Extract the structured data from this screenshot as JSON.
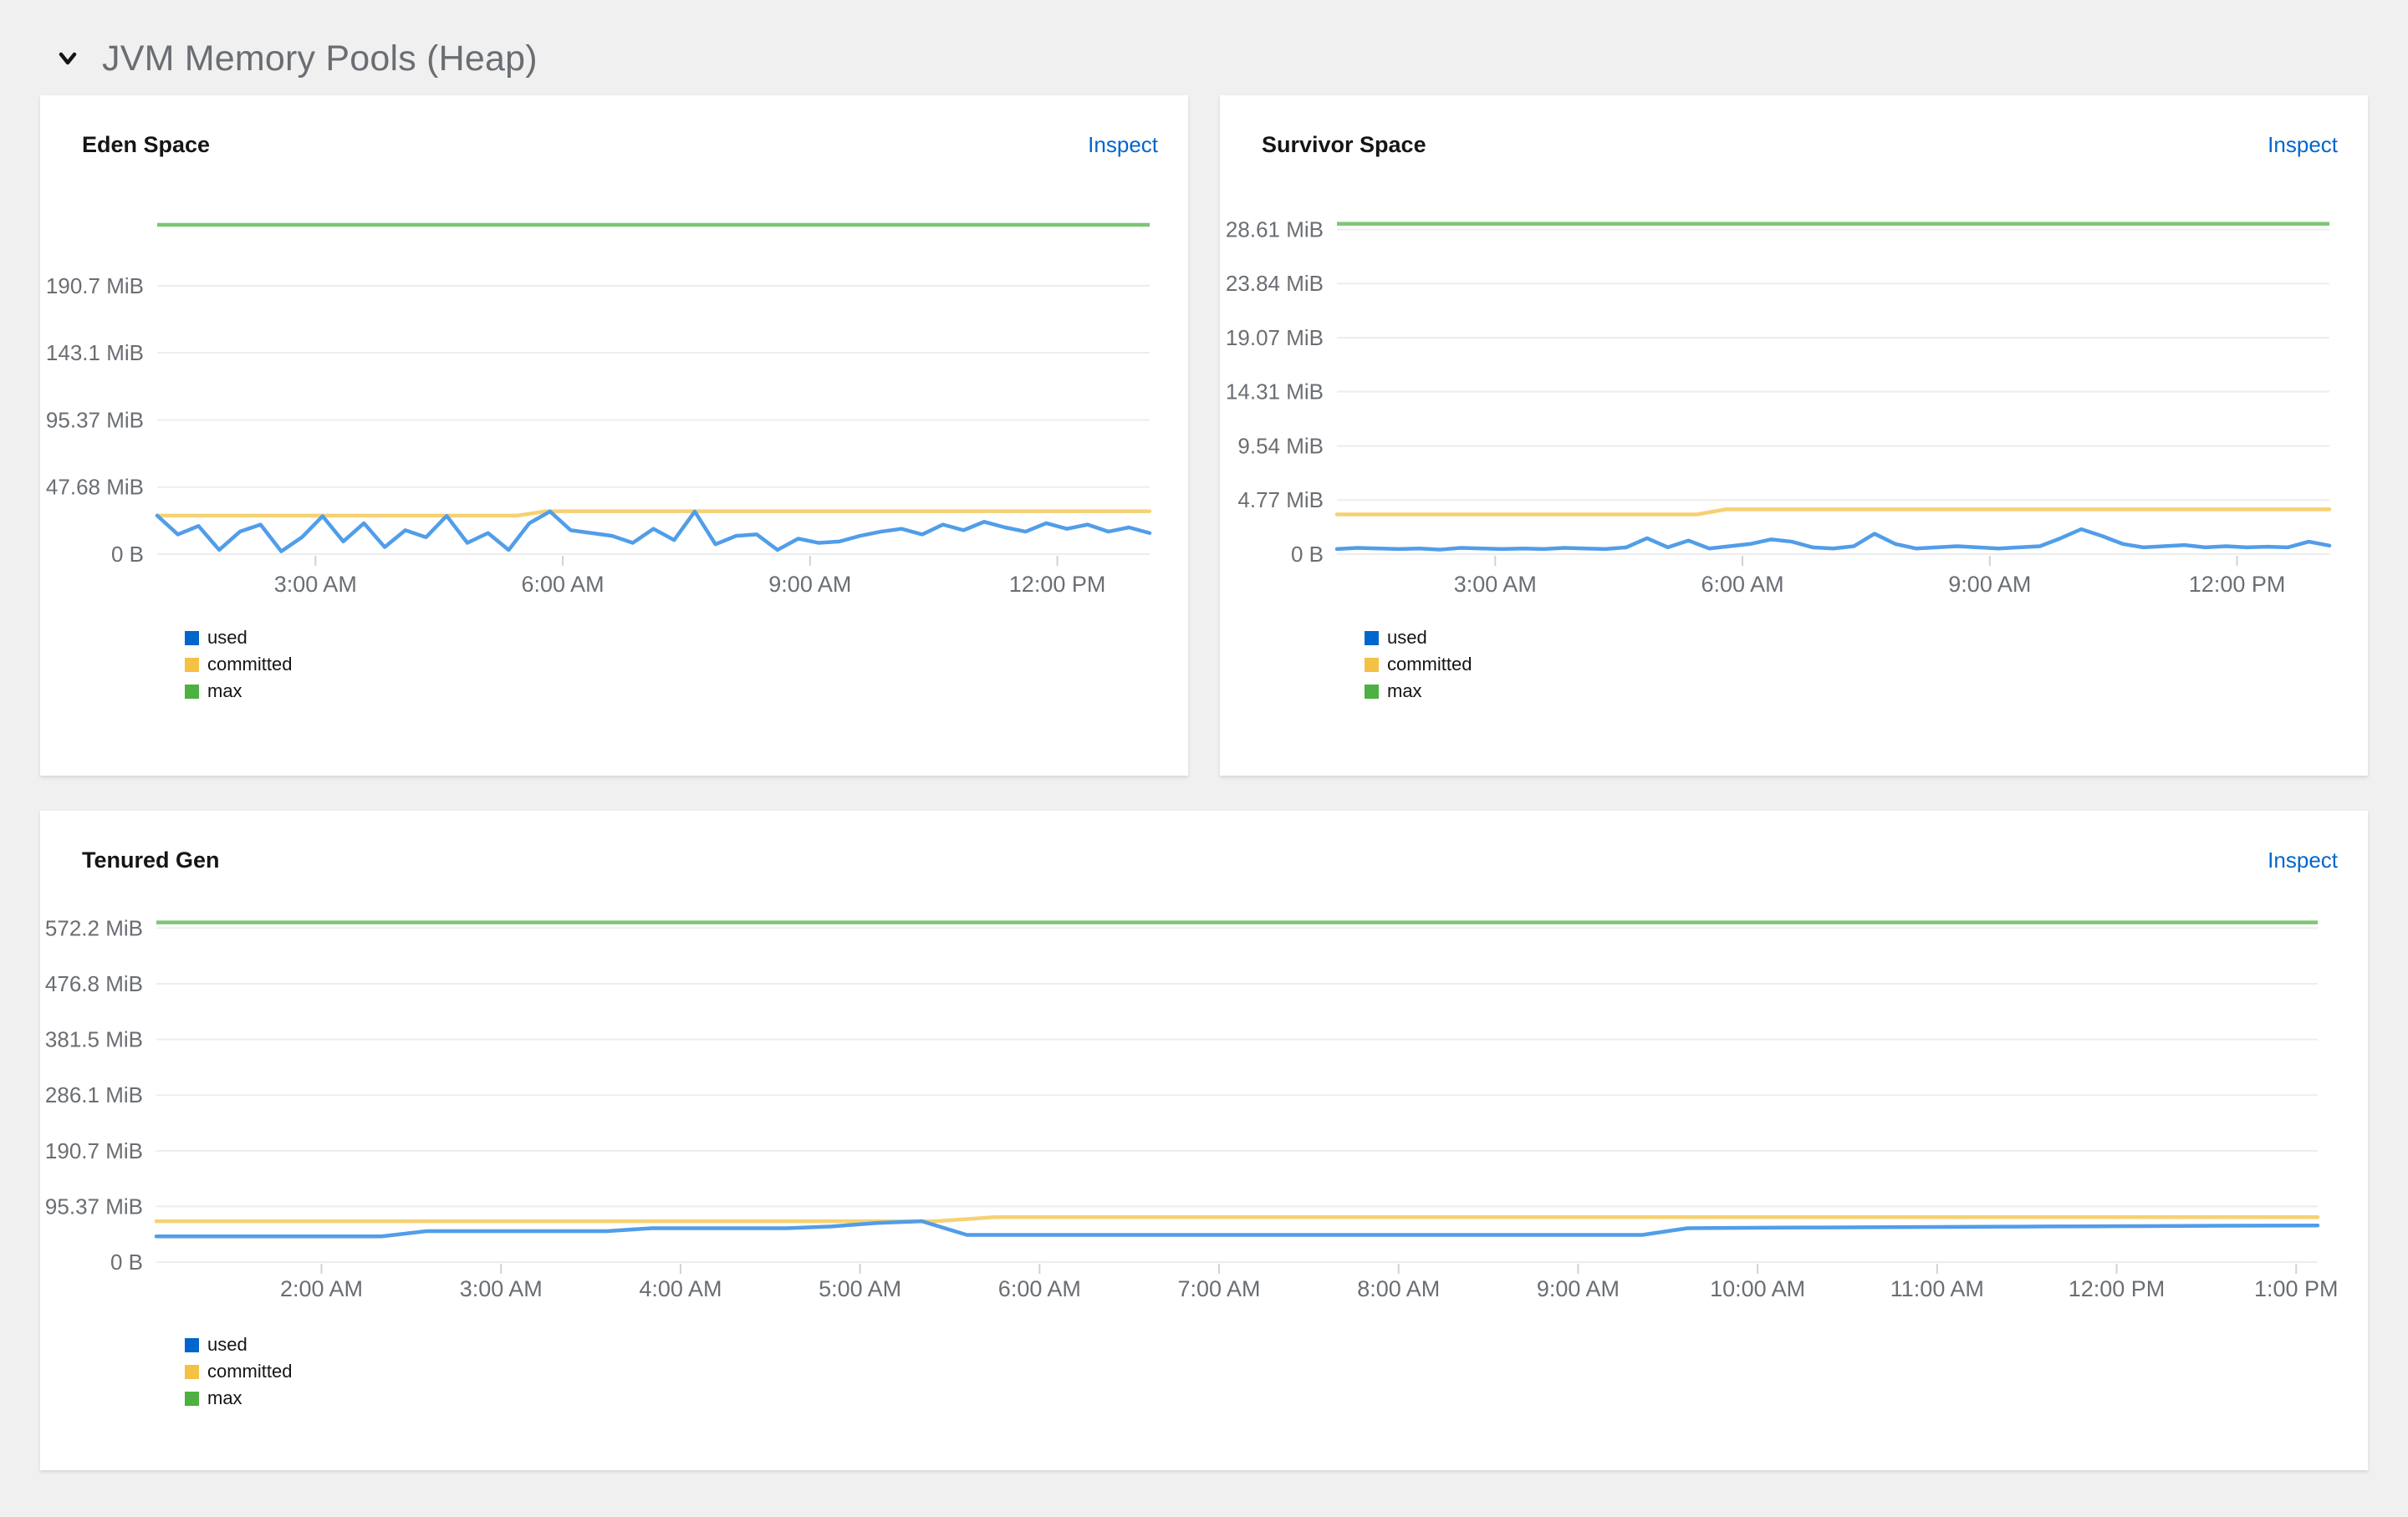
{
  "section": {
    "title": "JVM Memory Pools (Heap)"
  },
  "links": {
    "inspect": "Inspect"
  },
  "palette": {
    "line_used": "#519DE9",
    "line_committed": "#F6D173",
    "line_max": "#7CC674",
    "legend_used": "#0066CC",
    "legend_committed": "#F4C145",
    "legend_max": "#4CB140",
    "grid": "#EDEDED",
    "axis_tick": "#D2D2D2",
    "tick_label": "#6A6E73",
    "link": "#0066CC",
    "title_text": "#151515",
    "section_title": "#6A6E73",
    "page_bg": "#F0F0F0",
    "card_bg": "#FFFFFF"
  },
  "chart_data": [
    {
      "type": "line",
      "title": "Eden Space",
      "unit": "MiB",
      "x_domain": [
        1.08,
        13.12
      ],
      "x_ticks": [
        {
          "t": 3,
          "label": "3:00 AM"
        },
        {
          "t": 6,
          "label": "6:00 AM"
        },
        {
          "t": 9,
          "label": "9:00 AM"
        },
        {
          "t": 12,
          "label": "12:00 PM"
        }
      ],
      "y_domain": [
        0,
        250
      ],
      "y_ticks": [
        {
          "v": 0,
          "label": "0 B"
        },
        {
          "v": 47.68,
          "label": "47.68 MiB"
        },
        {
          "v": 95.37,
          "label": "95.37 MiB"
        },
        {
          "v": 143.1,
          "label": "143.1 MiB"
        },
        {
          "v": 190.7,
          "label": "190.7 MiB"
        }
      ],
      "grid": true,
      "legend_position": "bottom-left",
      "legend": [
        "used",
        "committed",
        "max"
      ],
      "series": {
        "used": {
          "values": [
            27.4,
            14,
            20,
            3,
            16,
            21,
            2,
            12,
            27,
            9,
            22,
            5,
            17,
            12,
            27.2,
            8,
            15,
            3,
            22,
            30.3,
            17,
            15,
            13,
            8,
            18,
            10,
            30.3,
            7,
            13,
            14,
            3,
            11,
            8,
            9,
            13,
            16,
            18,
            14,
            21,
            17,
            23,
            19,
            16,
            22,
            18,
            21,
            16,
            19,
            15
          ]
        },
        "committed": {
          "segments": [
            {
              "t": 1.08,
              "v": 27.4
            },
            {
              "t": 5.45,
              "v": 27.4
            },
            {
              "t": 5.8,
              "v": 30.5
            },
            {
              "t": 13.12,
              "v": 30.5
            }
          ]
        },
        "max": {
          "value": 234
        }
      }
    },
    {
      "type": "line",
      "title": "Survivor Space",
      "unit": "MiB",
      "x_domain": [
        1.08,
        13.12
      ],
      "x_ticks": [
        {
          "t": 3,
          "label": "3:00 AM"
        },
        {
          "t": 6,
          "label": "6:00 AM"
        },
        {
          "t": 9,
          "label": "9:00 AM"
        },
        {
          "t": 12,
          "label": "12:00 PM"
        }
      ],
      "y_domain": [
        0,
        31
      ],
      "y_ticks": [
        {
          "v": 0,
          "label": "0 B"
        },
        {
          "v": 4.77,
          "label": "4.77 MiB"
        },
        {
          "v": 9.54,
          "label": "9.54 MiB"
        },
        {
          "v": 14.31,
          "label": "14.31 MiB"
        },
        {
          "v": 19.07,
          "label": "19.07 MiB"
        },
        {
          "v": 23.84,
          "label": "23.84 MiB"
        },
        {
          "v": 28.61,
          "label": "28.61 MiB"
        }
      ],
      "grid": true,
      "legend_position": "bottom-left",
      "legend": [
        "used",
        "committed",
        "max"
      ],
      "series": {
        "used": {
          "values": [
            0.45,
            0.55,
            0.5,
            0.45,
            0.5,
            0.4,
            0.55,
            0.5,
            0.45,
            0.5,
            0.45,
            0.55,
            0.5,
            0.45,
            0.6,
            1.4,
            0.6,
            1.2,
            0.5,
            0.7,
            0.9,
            1.3,
            1.1,
            0.6,
            0.5,
            0.7,
            1.8,
            0.9,
            0.5,
            0.6,
            0.7,
            0.6,
            0.5,
            0.6,
            0.7,
            1.4,
            2.2,
            1.6,
            0.9,
            0.6,
            0.7,
            0.8,
            0.6,
            0.7,
            0.6,
            0.65,
            0.6,
            1.1,
            0.75
          ]
        },
        "committed": {
          "segments": [
            {
              "t": 1.08,
              "v": 3.5
            },
            {
              "t": 5.45,
              "v": 3.5
            },
            {
              "t": 5.8,
              "v": 3.95
            },
            {
              "t": 13.12,
              "v": 3.95
            }
          ]
        },
        "max": {
          "value": 29.1
        }
      }
    },
    {
      "type": "line",
      "title": "Tenured Gen",
      "unit": "MiB",
      "x_domain": [
        1.08,
        13.12
      ],
      "x_ticks": [
        {
          "t": 2,
          "label": "2:00 AM"
        },
        {
          "t": 3,
          "label": "3:00 AM"
        },
        {
          "t": 4,
          "label": "4:00 AM"
        },
        {
          "t": 5,
          "label": "5:00 AM"
        },
        {
          "t": 6,
          "label": "6:00 AM"
        },
        {
          "t": 7,
          "label": "7:00 AM"
        },
        {
          "t": 8,
          "label": "8:00 AM"
        },
        {
          "t": 9,
          "label": "9:00 AM"
        },
        {
          "t": 10,
          "label": "10:00 AM"
        },
        {
          "t": 11,
          "label": "11:00 AM"
        },
        {
          "t": 12,
          "label": "12:00 PM"
        },
        {
          "t": 13,
          "label": "1:00 PM"
        }
      ],
      "y_domain": [
        0,
        590
      ],
      "y_ticks": [
        {
          "v": 0,
          "label": "0 B"
        },
        {
          "v": 95.37,
          "label": "95.37 MiB"
        },
        {
          "v": 190.7,
          "label": "190.7 MiB"
        },
        {
          "v": 286.1,
          "label": "286.1 MiB"
        },
        {
          "v": 381.5,
          "label": "381.5 MiB"
        },
        {
          "v": 476.8,
          "label": "476.8 MiB"
        },
        {
          "v": 572.2,
          "label": "572.2 MiB"
        }
      ],
      "grid": true,
      "legend_position": "bottom-left",
      "legend": [
        "used",
        "committed",
        "max"
      ],
      "series": {
        "used": {
          "values": [
            44,
            44,
            44,
            44,
            44,
            44,
            53,
            53,
            53,
            53,
            53,
            58,
            58,
            58,
            58,
            61,
            67,
            70,
            46.5,
            46.5,
            46.5,
            46.5,
            46.5,
            46.5,
            46.5,
            46.5,
            46.5,
            46.5,
            46.5,
            46.5,
            46.5,
            46.5,
            46.5,
            46.5,
            58,
            58.5,
            59,
            59.3,
            59.6,
            60,
            60.3,
            60.6,
            61,
            61.3,
            61.6,
            62,
            62.3,
            62.5,
            62.7
          ]
        },
        "committed": {
          "segments": [
            {
              "t": 1.08,
              "v": 70
            },
            {
              "t": 5.42,
              "v": 70
            },
            {
              "t": 5.75,
              "v": 77
            },
            {
              "t": 13.12,
              "v": 77
            }
          ]
        },
        "max": {
          "value": 582
        }
      }
    }
  ]
}
